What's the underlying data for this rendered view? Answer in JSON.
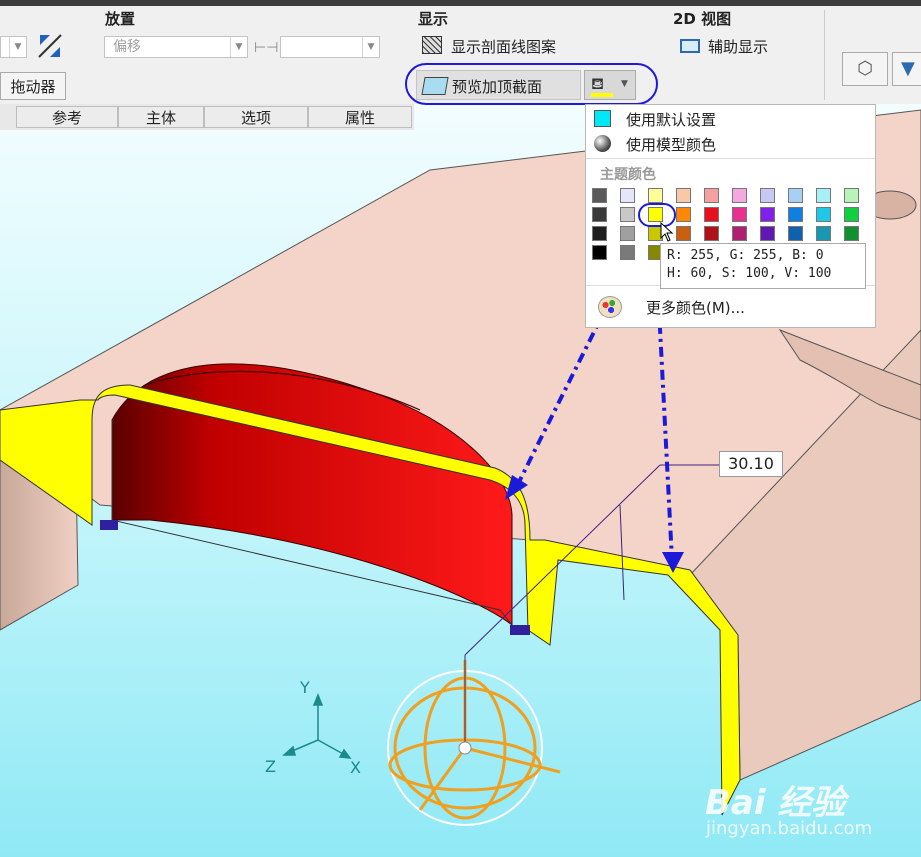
{
  "ribbon": {
    "placement": {
      "title": "放置",
      "offset_placeholder": "偏移",
      "drag_label": "拖动器"
    },
    "display": {
      "title": "显示",
      "show_hatch_label": "显示剖面线图案",
      "preview_cap_label": "预览加顶截面"
    },
    "view2d": {
      "title": "2D 视图",
      "aux_display_label": "辅助显示"
    }
  },
  "tabs": [
    "参考",
    "主体",
    "选项",
    "属性"
  ],
  "color_menu": {
    "default_label": "使用默认设置",
    "model_color_label": "使用模型颜色",
    "theme_colors_title": "主题颜色",
    "more_colors_label": "更多颜色(M)...",
    "theme_rows": [
      [
        "#5a5a5a",
        "#e6e6fa",
        "#ffff99",
        "#f8c8a8",
        "#f4a0a0",
        "#f4a8e0",
        "#c8c8f4",
        "#a8d0f4",
        "#a8f0f8",
        "#b8f4b8"
      ],
      [
        "#3a3a3a",
        "#c8c8c8",
        "#ffff00",
        "#ff8800",
        "#e8101c",
        "#e83090",
        "#8020e8",
        "#1080e0",
        "#20c8e8",
        "#10d040"
      ],
      [
        "#1e1e1e",
        "#a0a0a0",
        "#c8c800",
        "#c86010",
        "#b01018",
        "#b02070",
        "#6018b0",
        "#1060b0",
        "#1898b0",
        "#109030"
      ],
      [
        "#000000",
        "#7a7a7a",
        "#888800",
        "#804010",
        "#700c10",
        "#701448",
        "#401078",
        "#0c4070",
        "#106878",
        "#086020"
      ]
    ],
    "selected_color": "#ffff00",
    "tooltip_rgb": "R: 255, G: 255, B: 0",
    "tooltip_hsv": "H: 60, S: 100, V: 100"
  },
  "dimension_value": "30.10",
  "axes": {
    "x": "X",
    "y": "Y",
    "z": "Z"
  },
  "watermark": {
    "brand": "Bai 经验",
    "url": "jingyan.baidu.com"
  },
  "colors": {
    "viewport_bg": "#a8f0f8",
    "cap_section": "#ffff00",
    "model_face": "#f4d4c8",
    "cut_surface": "#dc1010",
    "annotation_blue": "#1a1ad8"
  }
}
